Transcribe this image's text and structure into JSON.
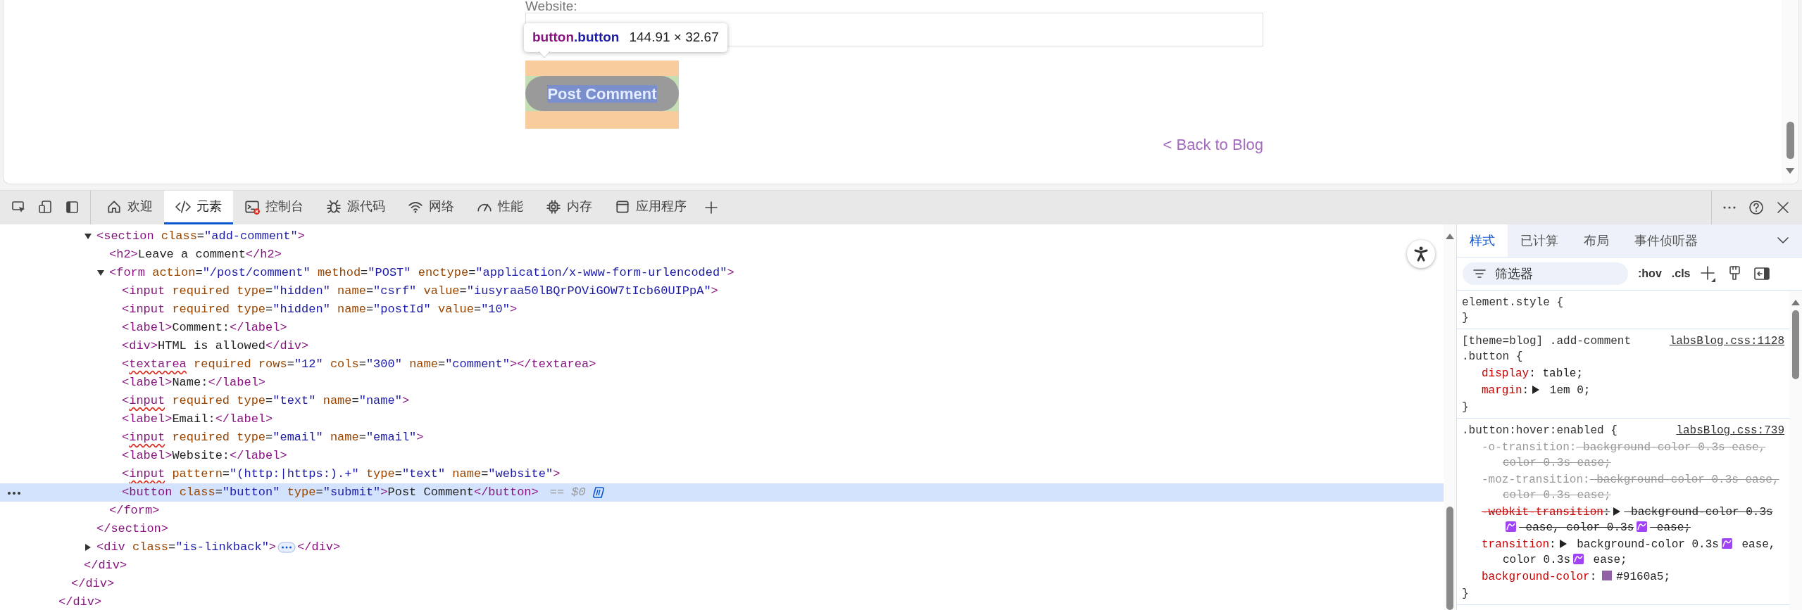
{
  "page": {
    "website_label": "Website:",
    "tooltip": {
      "tag": "button",
      "class_name": ".button",
      "size": "144.91 × 32.67"
    },
    "submit_button": "Post Comment",
    "back_link": "< Back to Blog"
  },
  "devtools": {
    "tabs": [
      {
        "label": "欢迎",
        "alert": false,
        "selected": false
      },
      {
        "label": "元素",
        "alert": false,
        "selected": true
      },
      {
        "label": "控制台",
        "alert": true,
        "selected": false
      },
      {
        "label": "源代码",
        "alert": false,
        "selected": false
      },
      {
        "label": "网络",
        "alert": false,
        "selected": false
      },
      {
        "label": "性能",
        "alert": false,
        "selected": false
      },
      {
        "label": "内存",
        "alert": false,
        "selected": false
      },
      {
        "label": "应用程序",
        "alert": false,
        "selected": false
      }
    ]
  },
  "elements": {
    "nodes": [
      {
        "close": "</div>",
        "selected": false,
        "children": [
          {
            "close": "</div>",
            "selected": false,
            "children": [
              {
                "close": "</div>",
                "selected": false,
                "children": [
                  {
                    "open": "<section class=\"add-comment\">",
                    "expanded": true,
                    "selected": false,
                    "close": "</section>",
                    "children": [
                      {
                        "text": "<h2>Leave a comment</h2>",
                        "flagged": false,
                        "selected": false
                      },
                      {
                        "open": "<form action=\"/post/comment\" method=\"POST\" enctype=\"application/x-www-form-urlencoded\">",
                        "expanded": true,
                        "selected": false,
                        "close": "</form>",
                        "children": [
                          {
                            "text": "<input required type=\"hidden\" name=\"csrf\" value=\"iusyraa50lBQrPOViGOW7tIcb60UIPpA\">",
                            "flagged": false,
                            "selected": false
                          },
                          {
                            "text": "<input required type=\"hidden\" name=\"postId\" value=\"10\">",
                            "flagged": false,
                            "selected": false
                          },
                          {
                            "text": "<label>Comment:</label>",
                            "flagged": false,
                            "selected": false
                          },
                          {
                            "text": "<div>HTML is allowed</div>",
                            "flagged": false,
                            "selected": false
                          },
                          {
                            "text": "<textarea required rows=\"12\" cols=\"300\" name=\"comment\"></textarea>",
                            "flagged": true,
                            "selected": false
                          },
                          {
                            "text": "<label>Name:</label>",
                            "flagged": false,
                            "selected": false
                          },
                          {
                            "text": "<input required type=\"text\" name=\"name\">",
                            "flagged": true,
                            "selected": false
                          },
                          {
                            "text": "<label>Email:</label>",
                            "flagged": false,
                            "selected": false
                          },
                          {
                            "text": "<input required type=\"email\" name=\"email\">",
                            "flagged": true,
                            "selected": false
                          },
                          {
                            "text": "<label>Website:</label>",
                            "flagged": false,
                            "selected": false
                          },
                          {
                            "text": "<input pattern=\"(http:|https:).+\" type=\"text\" name=\"website\">",
                            "flagged": true,
                            "selected": false
                          },
                          {
                            "text": "<button class=\"button\" type=\"submit\">Post Comment</button>",
                            "flagged": false,
                            "selected": true,
                            "suffix": "== $0"
                          }
                        ]
                      }
                    ]
                  },
                  {
                    "open": "<div class=\"is-linkback\">",
                    "expanded": false,
                    "selected": false,
                    "close": "</div>"
                  }
                ]
              }
            ]
          }
        ]
      }
    ]
  },
  "styles": {
    "tabs": [
      {
        "label": "样式",
        "selected": true
      },
      {
        "label": "已计算",
        "selected": false
      },
      {
        "label": "布局",
        "selected": false
      },
      {
        "label": "事件侦听器",
        "selected": false
      }
    ],
    "filter": {
      "placeholder": "筛选器"
    },
    "toggles": [
      ":hov",
      ".cls"
    ],
    "rules": [
      {
        "selector": "element.style {",
        "close": "}"
      },
      {
        "selector": "[theme=blog] .add-comment .button {",
        "source": "labsBlog.css:1128",
        "close": "}",
        "declarations": [
          {
            "struck": false,
            "dimmed": false,
            "segments": [
              {
                "kind": "property",
                "text": "display"
              },
              {
                "kind": "text",
                "text": ":"
              },
              {
                "kind": "text",
                "text": "table;"
              }
            ]
          },
          {
            "struck": false,
            "dimmed": false,
            "segments": [
              {
                "kind": "property",
                "text": "margin"
              },
              {
                "kind": "text",
                "text": ":"
              },
              {
                "kind": "toggle"
              },
              {
                "kind": "text",
                "text": "1em 0;"
              }
            ]
          }
        ]
      },
      {
        "selector": ".button:hover:enabled {",
        "source": "labsBlog.css:739",
        "close": "}",
        "declarations": [
          {
            "struck": true,
            "dimmed": true,
            "segments": [
              {
                "kind": "property",
                "text": "-o-transition"
              },
              {
                "kind": "text",
                "text": ":"
              },
              {
                "kind": "text",
                "text": "background-color 0.3s ease, color 0.3s ease;"
              }
            ]
          },
          {
            "struck": true,
            "dimmed": true,
            "segments": [
              {
                "kind": "property",
                "text": "-moz-transition"
              },
              {
                "kind": "text",
                "text": ":"
              },
              {
                "kind": "text",
                "text": "background-color 0.3s ease, color 0.3s ease;"
              }
            ]
          },
          {
            "struck": true,
            "dimmed": false,
            "segments": [
              {
                "kind": "property",
                "text": "-webkit-transition"
              },
              {
                "kind": "text",
                "text": ":"
              },
              {
                "kind": "toggle"
              },
              {
                "kind": "text",
                "text": "background-color 0.3s"
              },
              {
                "kind": "easing"
              },
              {
                "kind": "text",
                "text": "ease, color 0.3s"
              },
              {
                "kind": "easing"
              },
              {
                "kind": "text",
                "text": "ease;"
              }
            ]
          },
          {
            "struck": false,
            "dimmed": false,
            "segments": [
              {
                "kind": "property",
                "text": "transition"
              },
              {
                "kind": "text",
                "text": ":"
              },
              {
                "kind": "toggle"
              },
              {
                "kind": "text",
                "text": "background-color 0.3s"
              },
              {
                "kind": "easing"
              },
              {
                "kind": "text",
                "text": "ease, color 0.3s"
              },
              {
                "kind": "easing"
              },
              {
                "kind": "text",
                "text": "ease;"
              }
            ]
          },
          {
            "struck": false,
            "dimmed": false,
            "segments": [
              {
                "kind": "property",
                "text": "background-color"
              },
              {
                "kind": "text",
                "text": ":"
              },
              {
                "kind": "swatch",
                "color": "#9160a5"
              },
              {
                "kind": "text",
                "text": "#9160a5;"
              }
            ]
          }
        ]
      }
    ]
  }
}
